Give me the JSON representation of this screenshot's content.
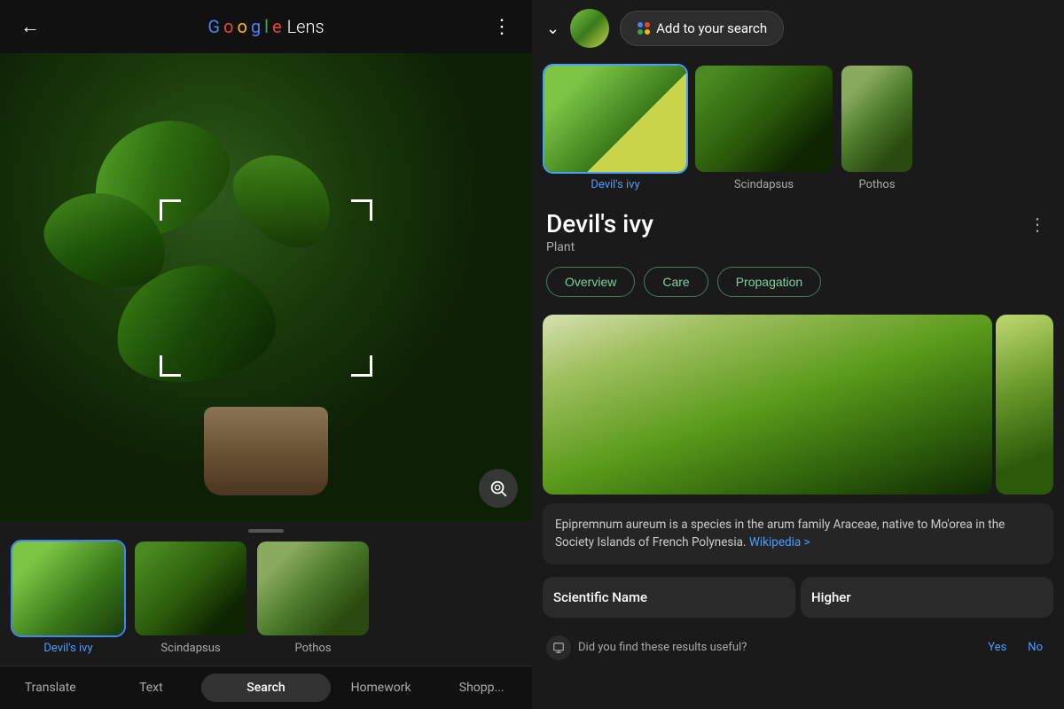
{
  "app": {
    "title_google": "Google",
    "title_lens": " Lens"
  },
  "left": {
    "back_label": "←",
    "more_label": "⋮",
    "thumbnails": [
      {
        "label": "Devil's ivy",
        "selected": true,
        "class": "thumb-plant-1"
      },
      {
        "label": "Scindapsus",
        "selected": false,
        "class": "thumb-plant-2"
      },
      {
        "label": "Pothos",
        "selected": false,
        "class": "thumb-plant-3"
      }
    ],
    "nav_tabs": [
      {
        "label": "Translate",
        "active": false
      },
      {
        "label": "Text",
        "active": false
      },
      {
        "label": "Search",
        "active": true
      },
      {
        "label": "Homework",
        "active": false
      },
      {
        "label": "Shopp...",
        "active": false
      }
    ]
  },
  "right": {
    "add_to_search": "Add to your search",
    "results": [
      {
        "label": "Devil's ivy",
        "selected": true
      },
      {
        "label": "Scindapsus",
        "selected": false
      },
      {
        "label": "Pothos",
        "selected": false
      }
    ],
    "plant_name": "Devil's ivy",
    "plant_type": "Plant",
    "tabs": [
      {
        "label": "Overview"
      },
      {
        "label": "Care"
      },
      {
        "label": "Propagation"
      }
    ],
    "description": "Epipremnum aureum is a species in the arum family Araceae, native to Mo'orea in the Society Islands of French Polynesia.",
    "wikipedia_label": "Wikipedia >",
    "bottom_cards": [
      {
        "label": "Scientific Name"
      },
      {
        "label": "Higher"
      }
    ],
    "feedback_question": "Did you find these results useful?",
    "feedback_yes": "Yes",
    "feedback_no": "No"
  }
}
